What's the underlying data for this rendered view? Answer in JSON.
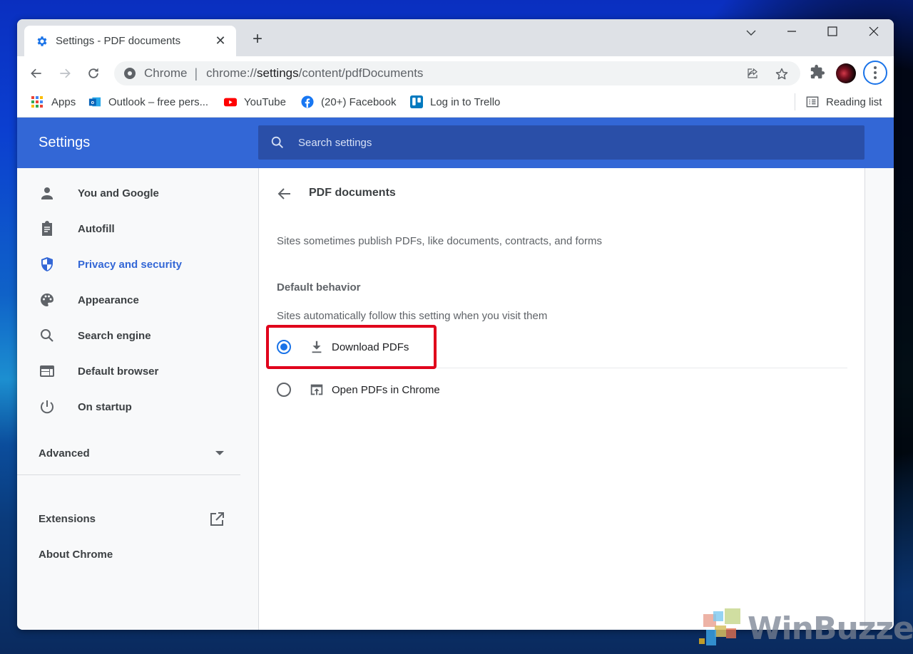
{
  "browser": {
    "tab": {
      "title": "Settings - PDF documents",
      "favicon": "gear-icon",
      "close_glyph": "✕"
    },
    "new_tab_glyph": "+",
    "window_controls": {
      "tab_search_glyph": "⌵",
      "minimize_glyph": "—",
      "maximize_glyph": "☐",
      "close_glyph": "✕"
    },
    "nav": {
      "back_glyph": "←",
      "forward_glyph": "→",
      "reload_glyph": "↻"
    },
    "omnibox": {
      "chip": "Chrome",
      "separator": "|",
      "url_prefix": "chrome://",
      "url_host": "settings",
      "url_path": "/content/pdfDocuments"
    },
    "bookmarks": [
      {
        "label": "Apps",
        "icon": "apps-grid-icon"
      },
      {
        "label": "Outlook – free pers...",
        "icon": "outlook-icon"
      },
      {
        "label": "YouTube",
        "icon": "youtube-icon"
      },
      {
        "label": "(20+) Facebook",
        "icon": "facebook-icon"
      },
      {
        "label": "Log in to Trello",
        "icon": "trello-icon"
      }
    ],
    "reading_list": "Reading list"
  },
  "settings": {
    "title": "Settings",
    "search_placeholder": "Search settings",
    "sidebar": {
      "items": [
        {
          "label": "You and Google",
          "icon": "person-icon",
          "active": false
        },
        {
          "label": "Autofill",
          "icon": "clipboard-icon",
          "active": false
        },
        {
          "label": "Privacy and security",
          "icon": "shield-icon",
          "active": true
        },
        {
          "label": "Appearance",
          "icon": "palette-icon",
          "active": false
        },
        {
          "label": "Search engine",
          "icon": "search-icon",
          "active": false
        },
        {
          "label": "Default browser",
          "icon": "browser-window-icon",
          "active": false
        },
        {
          "label": "On startup",
          "icon": "power-icon",
          "active": false
        }
      ],
      "advanced": "Advanced",
      "extensions": "Extensions",
      "about": "About Chrome"
    },
    "page": {
      "title": "PDF documents",
      "description": "Sites sometimes publish PDFs, like documents, contracts, and forms",
      "section_heading": "Default behavior",
      "section_subtitle": "Sites automatically follow this setting when you visit them",
      "options": [
        {
          "label": "Download PDFs",
          "icon": "download-icon",
          "selected": true
        },
        {
          "label": "Open PDFs in Chrome",
          "icon": "open-in-browser-icon",
          "selected": false
        }
      ]
    }
  },
  "colors": {
    "header_blue": "#3367d6",
    "search_blue": "#2a4fa8",
    "accent": "#1a73e8",
    "highlight_red": "#e0001b"
  },
  "watermark": "WinBuzzer"
}
